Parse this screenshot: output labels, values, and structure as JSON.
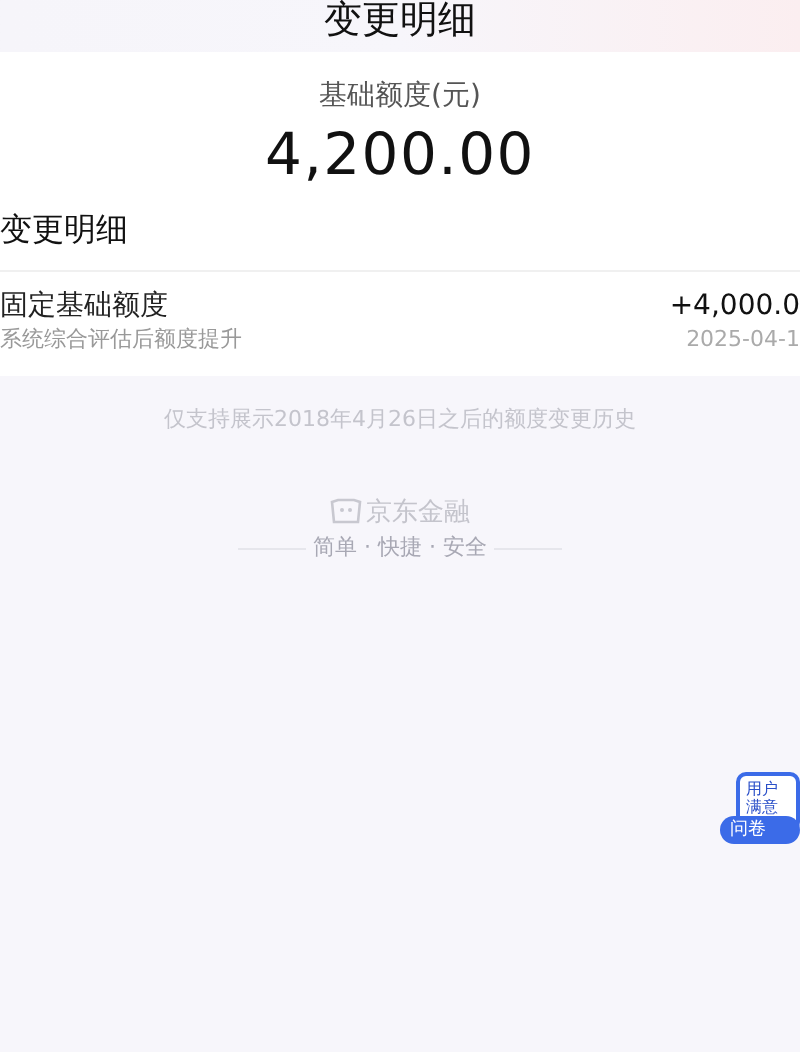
{
  "nav": {
    "title": "变更明细"
  },
  "summary": {
    "label": "基础额度(元)",
    "amount": "4,200.00"
  },
  "section_title": "变更明细",
  "changes": [
    {
      "title": "固定基础额度",
      "description": "系统综合评估后额度提升",
      "amount": "+4,000.0",
      "date": "2025-04-1"
    }
  ],
  "note": "仅支持展示2018年4月26日之后的额度变更历史",
  "footer": {
    "brand": "京东金融",
    "slogan": "简单 · 快捷 · 安全"
  },
  "survey_widget": {
    "lines": [
      "用户",
      "满意"
    ],
    "button": "问卷"
  }
}
